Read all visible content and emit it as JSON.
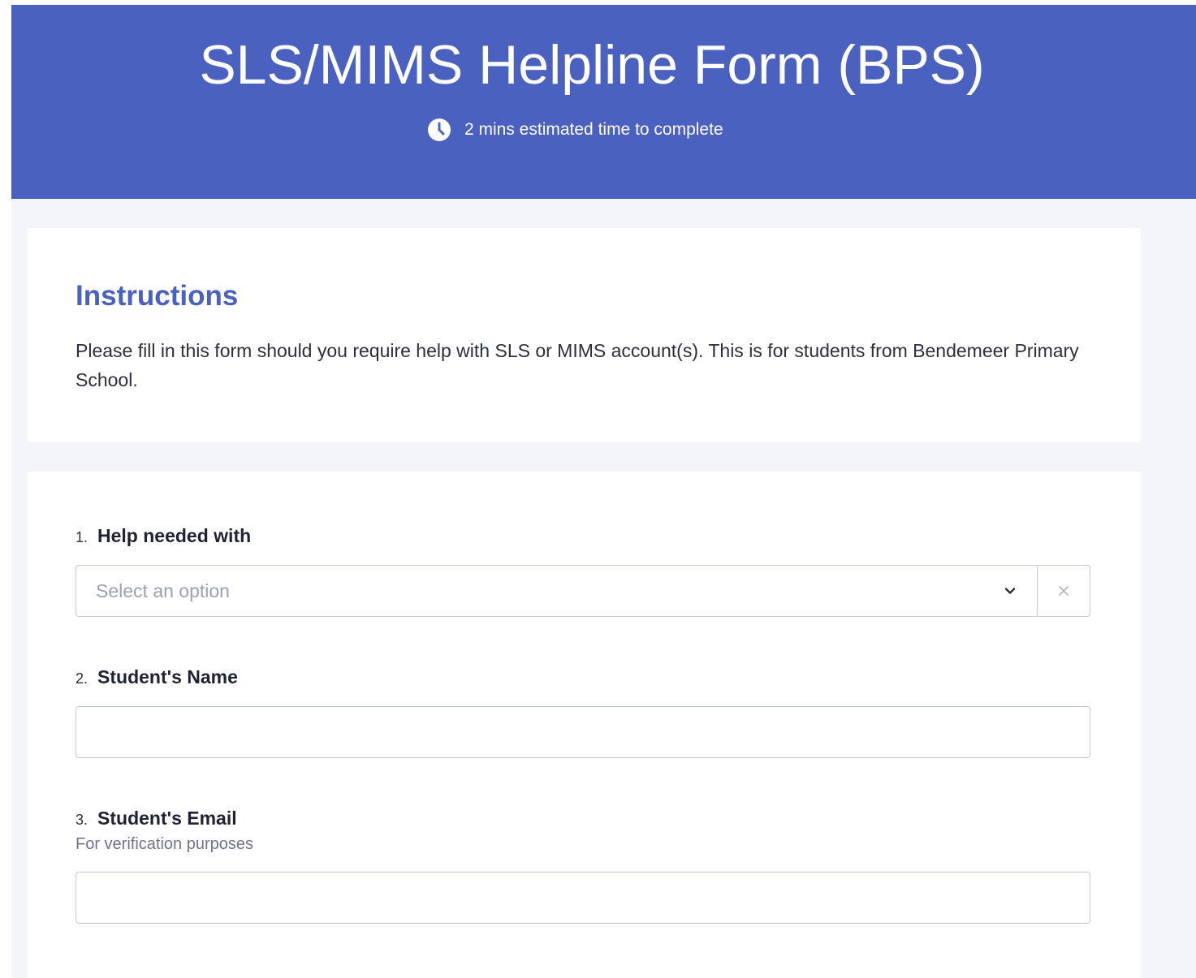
{
  "header": {
    "title": "SLS/MIMS Helpline Form (BPS)",
    "estimate": "2 mins estimated time to complete",
    "clock_icon": "clock-icon",
    "bg_color": "#4b61bf"
  },
  "instructions": {
    "title": "Instructions",
    "body": "Please fill in this form should you require help with SLS or MIMS account(s). This is for students from Bendemeer Primary School."
  },
  "questions": [
    {
      "number": "1.",
      "label": "Help needed with",
      "type": "dropdown",
      "placeholder": "Select an option",
      "icons": [
        "chevron-down-icon",
        "close-icon"
      ]
    },
    {
      "number": "2.",
      "label": "Student's Name",
      "type": "text",
      "value": ""
    },
    {
      "number": "3.",
      "label": "Student's Email",
      "description": "For verification purposes",
      "type": "text",
      "value": ""
    }
  ],
  "colors": {
    "accent": "#4b61bf",
    "page_bg": "#f4f5fb",
    "border": "#c5c9d6",
    "muted_text": "#6d7593"
  }
}
